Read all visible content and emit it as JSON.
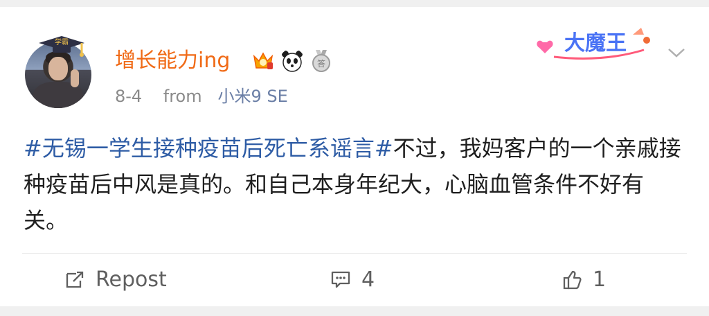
{
  "post": {
    "author": {
      "name": "增长能力ing",
      "cap_text": "学霸",
      "badges": [
        "crown-badge",
        "panda-badge",
        "answer-medal-badge"
      ],
      "medal_text": "答"
    },
    "title_badge": "大魔王",
    "meta": {
      "date": "8-4",
      "from_label": "from",
      "device": "小米9 SE"
    },
    "content": {
      "hashtag": "#无锡一学生接种疫苗后死亡系谣言#",
      "text": "不过，我妈客户的一个亲戚接种疫苗后中风是真的。和自己本身年纪大，心脑血管条件不好有关。"
    },
    "actions": {
      "repost_label": "Repost",
      "comment_count": "4",
      "like_count": "1"
    }
  },
  "colors": {
    "username": "#f06a16",
    "hashtag": "#2e5ca5",
    "meta_text": "#8a8a8a",
    "background": "#f0f0f0",
    "card": "#ffffff"
  }
}
